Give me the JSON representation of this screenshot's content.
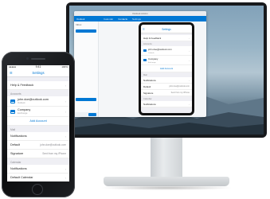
{
  "monitor": {
    "window_title": "Outlook Add-in",
    "window_tabs": [
      "Outlook",
      "Calendar",
      "Contacts",
      "Settings"
    ],
    "sidebar_header": "Inbox",
    "simulator": {
      "title": "Settings",
      "rows": {
        "help": "Help & Feedback",
        "accounts_header": "Accounts",
        "account1_name": "john.doe@outlook.com",
        "account1_sub": "Outlook",
        "account2_name": "Company",
        "account2_sub": "Exchange",
        "add_account": "Add Account",
        "mail_header": "Mail",
        "notifications": "Notifications",
        "default_label": "Default",
        "default_value": "john.doe@outlook.com",
        "signature_label": "Signature",
        "signature_value": "Sent from my iPhone",
        "calendar_header": "Calendar",
        "cal_notifications": "Notifications"
      }
    }
  },
  "phone": {
    "status_time": "9:41",
    "status_left": "●●●●●",
    "status_right": "100%",
    "title": "Settings",
    "menu_icon": "menu-icon",
    "help": "Help & Feedback",
    "accounts_header": "Accounts",
    "account1_name": "john.doe@outlook.com",
    "account1_sub": "Outlook",
    "account2_name": "Company",
    "account2_sub": "Exchange",
    "add_account": "Add Account",
    "mail_header": "Mail",
    "notifications": "Notifications",
    "default_label": "Default",
    "default_value": "john.doe@outlook.com",
    "signature_label": "Signature",
    "signature_value": "Sent from my iPhone",
    "calendar_header": "Calendar",
    "cal_notifications": "Notifications",
    "default_calendar": "Default Calendar"
  },
  "colors": {
    "accent": "#0078d4",
    "background": "#efeff4"
  }
}
